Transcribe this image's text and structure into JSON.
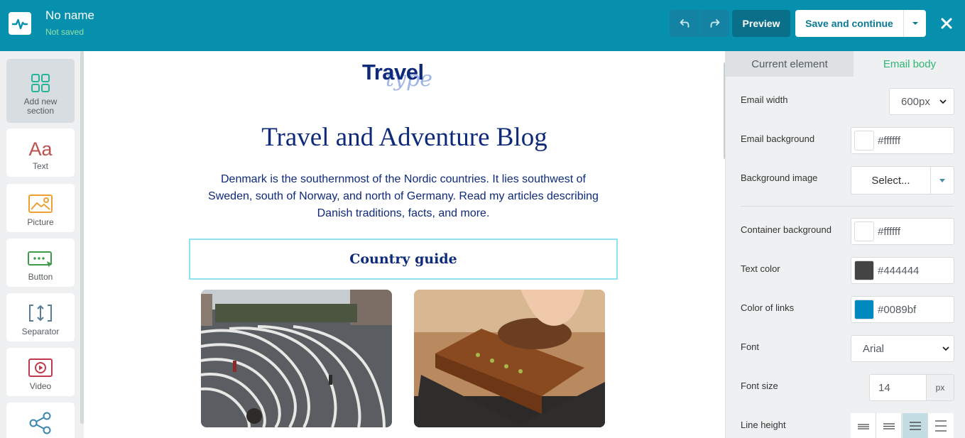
{
  "header": {
    "title": "No name",
    "status": "Not saved",
    "preview_label": "Preview",
    "save_label": "Save and continue",
    "icons": [
      "logo-pulse-icon",
      "undo-icon",
      "redo-icon",
      "chevron-down-icon",
      "close-icon"
    ],
    "colors": {
      "bar": "#0790ae",
      "status": "#8fe0a6",
      "save_text": "#0b7a96"
    }
  },
  "tools": [
    {
      "label": "Add new section",
      "icon": "grid-icon"
    },
    {
      "label": "Text",
      "icon": "text-icon"
    },
    {
      "label": "Picture",
      "icon": "picture-icon"
    },
    {
      "label": "Button",
      "icon": "button-icon"
    },
    {
      "label": "Separator",
      "icon": "separator-icon"
    },
    {
      "label": "Video",
      "icon": "video-icon"
    },
    {
      "label": "",
      "icon": "share-icon"
    }
  ],
  "email": {
    "brand": "Travel",
    "brand_script": "type",
    "title": "Travel and Adventure Blog",
    "intro": "Denmark is the southernmost of the Nordic countries. It lies southwest of Sweden, south of Norway, and north of Germany. Read my articles describing Danish traditions, facts, and more.",
    "section_heading": "Country guide",
    "images": [
      "street-photo",
      "cake-photo"
    ]
  },
  "panel": {
    "tabs": [
      "Current element",
      "Email body"
    ],
    "active_tab": "Email body",
    "fields": {
      "email_width": {
        "label": "Email width",
        "value": "600px"
      },
      "email_background": {
        "label": "Email background",
        "value": "#ffffff"
      },
      "background_image": {
        "label": "Background image",
        "value": "Select..."
      },
      "container_background": {
        "label": "Container background",
        "value": "#ffffff"
      },
      "text_color": {
        "label": "Text color",
        "value": "#444444"
      },
      "link_color": {
        "label": "Color of links",
        "value": "#0089bf"
      },
      "font": {
        "label": "Font",
        "value": "Arial"
      },
      "font_size": {
        "label": "Font size",
        "value": "14",
        "unit": "px"
      },
      "line_height": {
        "label": "Line height",
        "options": 4,
        "selected": 3
      }
    }
  }
}
